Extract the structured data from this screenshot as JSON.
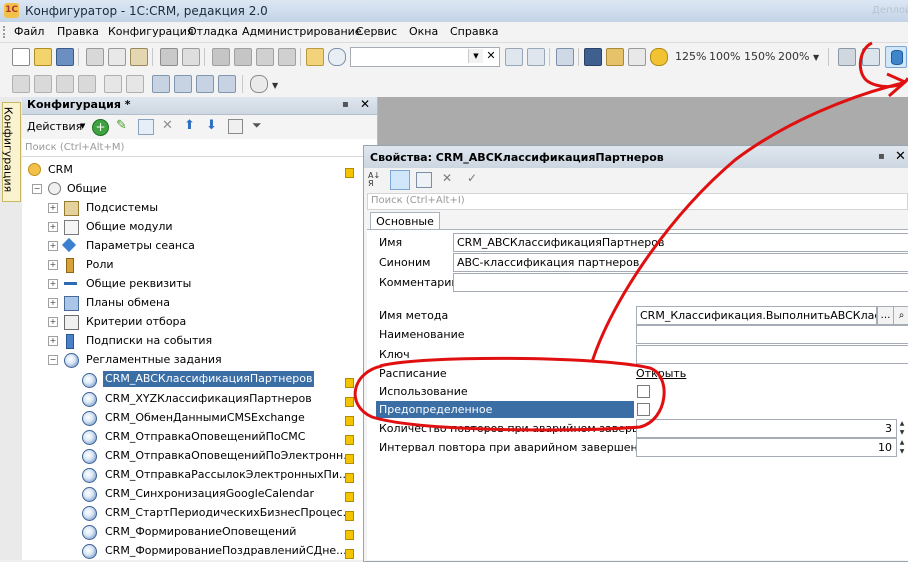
{
  "window": {
    "title": "Конфигуратор - 1С:CRM, редакция 2.0",
    "ghost_caption": "Деплой"
  },
  "menu": [
    "Файл",
    "Правка",
    "Конфигурация",
    "Отладка",
    "Администрирование",
    "Сервис",
    "Окна",
    "Справка"
  ],
  "toolbar": {
    "zoom_levels": [
      "125%",
      "100%",
      "150%",
      "200%"
    ]
  },
  "side_tab": "Конфигурация",
  "config_panel": {
    "title": "Конфигурация *",
    "actions_label": "Действия",
    "search_placeholder": "Поиск (Ctrl+Alt+M)",
    "tree": [
      {
        "label": "CRM"
      },
      {
        "label": "Общие"
      },
      {
        "label": "Подсистемы"
      },
      {
        "label": "Общие модули"
      },
      {
        "label": "Параметры сеанса"
      },
      {
        "label": "Роли"
      },
      {
        "label": "Общие реквизиты"
      },
      {
        "label": "Планы обмена"
      },
      {
        "label": "Критерии отбора"
      },
      {
        "label": "Подписки на события"
      },
      {
        "label": "Регламентные задания"
      },
      {
        "label": "CRM_ABCКлассификацияПартнеров"
      },
      {
        "label": "CRM_XYZКлассификацияПартнеров"
      },
      {
        "label": "CRM_ОбменДаннымиCMSExchange"
      },
      {
        "label": "CRM_ОтправкаОповещенийПоСМС"
      },
      {
        "label": "CRM_ОтправкаОповещенийПоЭлектронн..."
      },
      {
        "label": "CRM_ОтправкаРассылокЭлектронныхПи..."
      },
      {
        "label": "CRM_СинхронизацияGoogleCalendar"
      },
      {
        "label": "CRM_СтартПериодическихБизнесПроцес..."
      },
      {
        "label": "CRM_ФормированиеОповещений"
      },
      {
        "label": "CRM_ФормированиеПоздравленийСДне..."
      }
    ]
  },
  "properties": {
    "title": "Свойства: CRM_ABCКлассификацияПартнеров",
    "search_placeholder": "Поиск (Ctrl+Alt+I)",
    "tab": "Основные",
    "name_label": "Имя",
    "name_value": "CRM_ABCКлассификацияПартнеров",
    "synonym_label": "Синоним",
    "synonym_value": "ABC-классификация партнеров",
    "comment_label": "Комментарий",
    "comment_value": "",
    "method_label": "Имя метода",
    "method_value": "CRM_Классификация.ВыполнитьABCКлассиф",
    "title_label": "Наименование",
    "key_label": "Ключ",
    "schedule_label": "Расписание",
    "schedule_link": "Открыть",
    "usage_label": "Использование",
    "usage_checked": false,
    "predefined_label": "Предопределенное",
    "predefined_checked": false,
    "retry_count_label": "Количество повторов при аварийном завершении",
    "retry_count_value": "3",
    "retry_interval_label": "Интервал повтора при аварийном завершении",
    "retry_interval_value": "10"
  },
  "colors": {
    "selection": "#3a6ea5",
    "annotation": "#e01010",
    "lock": "#f5c400"
  }
}
